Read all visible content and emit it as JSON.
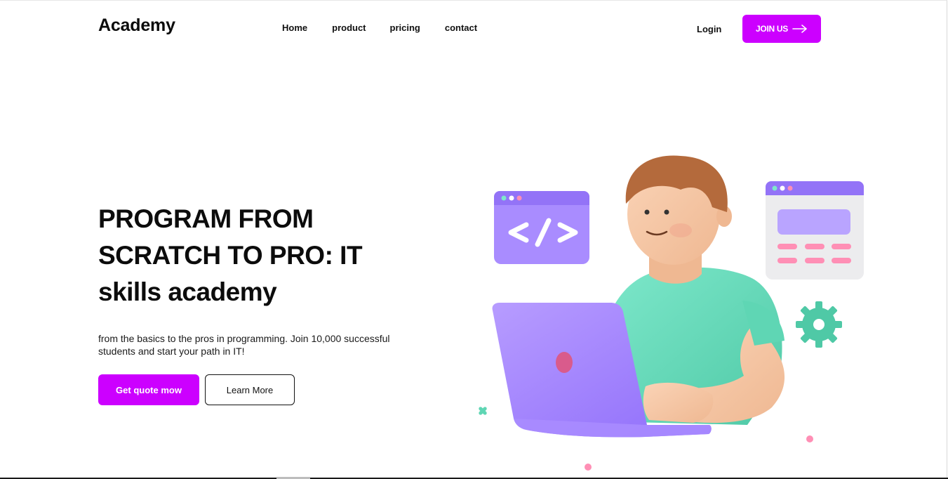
{
  "header": {
    "logo": "Academy",
    "nav": [
      {
        "label": "Home"
      },
      {
        "label": "product"
      },
      {
        "label": "pricing"
      },
      {
        "label": "contact"
      }
    ],
    "login_label": "Login",
    "join_label": "JOIN US",
    "join_icon": "arrow-right-icon"
  },
  "hero": {
    "title": "PROGRAM FROM SCRATCH TO PRO: IT skills academy",
    "subtitle": "from the basics to the pros in programming. Join 10,000 successful students and start your path in IT!",
    "primary_button": "Get quote mow",
    "secondary_button": "Learn More",
    "illustration_icons": [
      "code-window-icon",
      "ui-window-icon",
      "gear-icon",
      "laptop-icon"
    ]
  },
  "colors": {
    "accent": "#cc00ff",
    "purple_light": "#b9a4ff",
    "purple": "#9b7bff",
    "teal": "#5fd6b4",
    "pink": "#ff8fb5",
    "skin": "#f4c5a3",
    "hair": "#b46a3c"
  }
}
